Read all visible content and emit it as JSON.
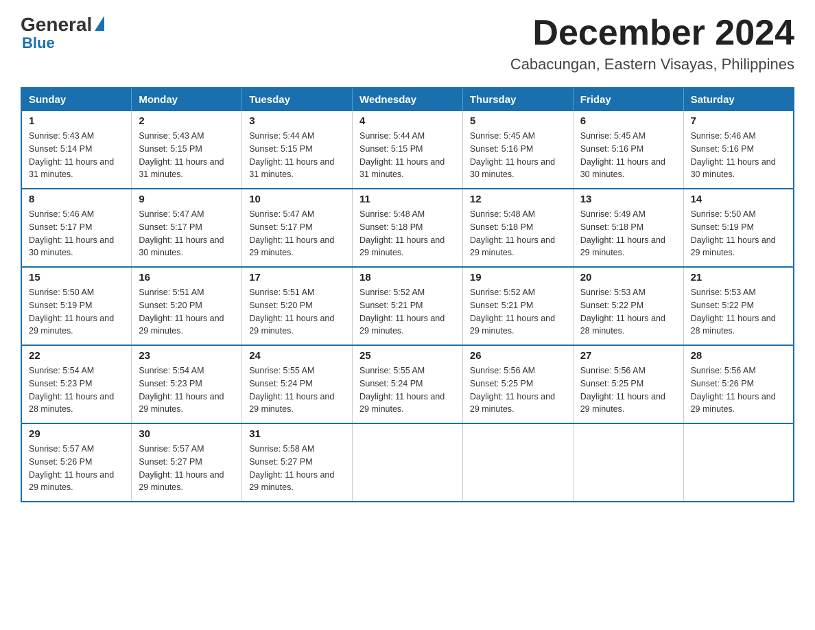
{
  "logo": {
    "general": "General",
    "blue": "Blue"
  },
  "header": {
    "month": "December 2024",
    "location": "Cabacungan, Eastern Visayas, Philippines"
  },
  "weekdays": [
    "Sunday",
    "Monday",
    "Tuesday",
    "Wednesday",
    "Thursday",
    "Friday",
    "Saturday"
  ],
  "weeks": [
    [
      {
        "day": "1",
        "sunrise": "5:43 AM",
        "sunset": "5:14 PM",
        "daylight": "11 hours and 31 minutes."
      },
      {
        "day": "2",
        "sunrise": "5:43 AM",
        "sunset": "5:15 PM",
        "daylight": "11 hours and 31 minutes."
      },
      {
        "day": "3",
        "sunrise": "5:44 AM",
        "sunset": "5:15 PM",
        "daylight": "11 hours and 31 minutes."
      },
      {
        "day": "4",
        "sunrise": "5:44 AM",
        "sunset": "5:15 PM",
        "daylight": "11 hours and 31 minutes."
      },
      {
        "day": "5",
        "sunrise": "5:45 AM",
        "sunset": "5:16 PM",
        "daylight": "11 hours and 30 minutes."
      },
      {
        "day": "6",
        "sunrise": "5:45 AM",
        "sunset": "5:16 PM",
        "daylight": "11 hours and 30 minutes."
      },
      {
        "day": "7",
        "sunrise": "5:46 AM",
        "sunset": "5:16 PM",
        "daylight": "11 hours and 30 minutes."
      }
    ],
    [
      {
        "day": "8",
        "sunrise": "5:46 AM",
        "sunset": "5:17 PM",
        "daylight": "11 hours and 30 minutes."
      },
      {
        "day": "9",
        "sunrise": "5:47 AM",
        "sunset": "5:17 PM",
        "daylight": "11 hours and 30 minutes."
      },
      {
        "day": "10",
        "sunrise": "5:47 AM",
        "sunset": "5:17 PM",
        "daylight": "11 hours and 29 minutes."
      },
      {
        "day": "11",
        "sunrise": "5:48 AM",
        "sunset": "5:18 PM",
        "daylight": "11 hours and 29 minutes."
      },
      {
        "day": "12",
        "sunrise": "5:48 AM",
        "sunset": "5:18 PM",
        "daylight": "11 hours and 29 minutes."
      },
      {
        "day": "13",
        "sunrise": "5:49 AM",
        "sunset": "5:18 PM",
        "daylight": "11 hours and 29 minutes."
      },
      {
        "day": "14",
        "sunrise": "5:50 AM",
        "sunset": "5:19 PM",
        "daylight": "11 hours and 29 minutes."
      }
    ],
    [
      {
        "day": "15",
        "sunrise": "5:50 AM",
        "sunset": "5:19 PM",
        "daylight": "11 hours and 29 minutes."
      },
      {
        "day": "16",
        "sunrise": "5:51 AM",
        "sunset": "5:20 PM",
        "daylight": "11 hours and 29 minutes."
      },
      {
        "day": "17",
        "sunrise": "5:51 AM",
        "sunset": "5:20 PM",
        "daylight": "11 hours and 29 minutes."
      },
      {
        "day": "18",
        "sunrise": "5:52 AM",
        "sunset": "5:21 PM",
        "daylight": "11 hours and 29 minutes."
      },
      {
        "day": "19",
        "sunrise": "5:52 AM",
        "sunset": "5:21 PM",
        "daylight": "11 hours and 29 minutes."
      },
      {
        "day": "20",
        "sunrise": "5:53 AM",
        "sunset": "5:22 PM",
        "daylight": "11 hours and 28 minutes."
      },
      {
        "day": "21",
        "sunrise": "5:53 AM",
        "sunset": "5:22 PM",
        "daylight": "11 hours and 28 minutes."
      }
    ],
    [
      {
        "day": "22",
        "sunrise": "5:54 AM",
        "sunset": "5:23 PM",
        "daylight": "11 hours and 28 minutes."
      },
      {
        "day": "23",
        "sunrise": "5:54 AM",
        "sunset": "5:23 PM",
        "daylight": "11 hours and 29 minutes."
      },
      {
        "day": "24",
        "sunrise": "5:55 AM",
        "sunset": "5:24 PM",
        "daylight": "11 hours and 29 minutes."
      },
      {
        "day": "25",
        "sunrise": "5:55 AM",
        "sunset": "5:24 PM",
        "daylight": "11 hours and 29 minutes."
      },
      {
        "day": "26",
        "sunrise": "5:56 AM",
        "sunset": "5:25 PM",
        "daylight": "11 hours and 29 minutes."
      },
      {
        "day": "27",
        "sunrise": "5:56 AM",
        "sunset": "5:25 PM",
        "daylight": "11 hours and 29 minutes."
      },
      {
        "day": "28",
        "sunrise": "5:56 AM",
        "sunset": "5:26 PM",
        "daylight": "11 hours and 29 minutes."
      }
    ],
    [
      {
        "day": "29",
        "sunrise": "5:57 AM",
        "sunset": "5:26 PM",
        "daylight": "11 hours and 29 minutes."
      },
      {
        "day": "30",
        "sunrise": "5:57 AM",
        "sunset": "5:27 PM",
        "daylight": "11 hours and 29 minutes."
      },
      {
        "day": "31",
        "sunrise": "5:58 AM",
        "sunset": "5:27 PM",
        "daylight": "11 hours and 29 minutes."
      },
      null,
      null,
      null,
      null
    ]
  ],
  "labels": {
    "sunrise": "Sunrise: ",
    "sunset": "Sunset: ",
    "daylight": "Daylight: "
  }
}
